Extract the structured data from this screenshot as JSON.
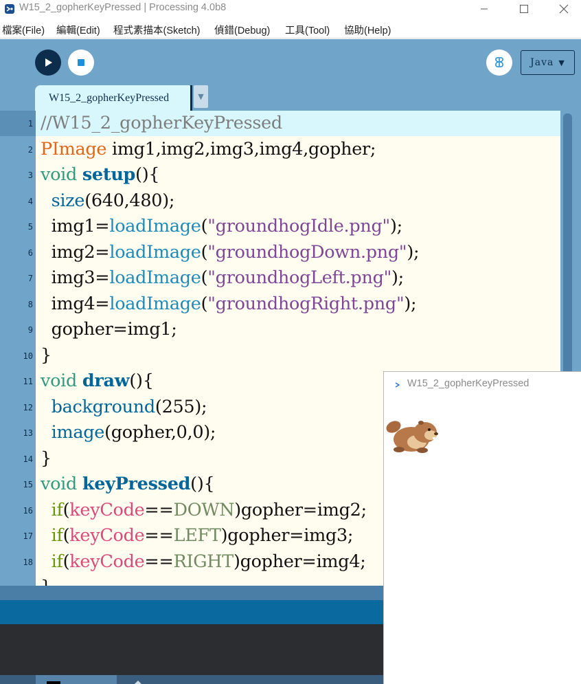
{
  "window": {
    "title": "W15_2_gopherKeyPressed | Processing 4.0b8"
  },
  "menu": [
    {
      "label": "檔案(File)"
    },
    {
      "label": "編輯(Edit)"
    },
    {
      "label": "程式素描本(Sketch)"
    },
    {
      "label": "偵錯(Debug)"
    },
    {
      "label": "工具(Tool)"
    },
    {
      "label": "協助(Help)"
    }
  ],
  "toolbar": {
    "mode_label": "Java",
    "mode_arrow": "▼"
  },
  "editor": {
    "tab_name": "W15_2_gopherKeyPressed",
    "tab_menu_arrow": "▼",
    "line_numbers": [
      "1",
      "2",
      "3",
      "4",
      "5",
      "6",
      "7",
      "8",
      "9",
      "10",
      "11",
      "12",
      "13",
      "14",
      "15",
      "16",
      "17",
      "18"
    ],
    "lines": [
      [
        {
          "t": "//W15_2_gopherKeyPressed",
          "c": "k-comment"
        }
      ],
      [
        {
          "t": "PImage",
          "c": "k-type"
        },
        {
          "t": " img1,img2,img3,img4,gopher;",
          "c": ""
        }
      ],
      [
        {
          "t": "void",
          "c": "k-void"
        },
        {
          "t": " ",
          "c": ""
        },
        {
          "t": "setup",
          "c": "k-fn"
        },
        {
          "t": "(){",
          "c": ""
        }
      ],
      [
        {
          "t": "  ",
          "c": ""
        },
        {
          "t": "size",
          "c": "k-call"
        },
        {
          "t": "(640,480);",
          "c": ""
        }
      ],
      [
        {
          "t": "  img1=",
          "c": ""
        },
        {
          "t": "loadImage",
          "c": "k-load"
        },
        {
          "t": "(",
          "c": ""
        },
        {
          "t": "\"groundhogIdle.png\"",
          "c": "k-str"
        },
        {
          "t": ");",
          "c": ""
        }
      ],
      [
        {
          "t": "  img2=",
          "c": ""
        },
        {
          "t": "loadImage",
          "c": "k-load"
        },
        {
          "t": "(",
          "c": ""
        },
        {
          "t": "\"groundhogDown.png\"",
          "c": "k-str"
        },
        {
          "t": ");",
          "c": ""
        }
      ],
      [
        {
          "t": "  img3=",
          "c": ""
        },
        {
          "t": "loadImage",
          "c": "k-load"
        },
        {
          "t": "(",
          "c": ""
        },
        {
          "t": "\"groundhogLeft.png\"",
          "c": "k-str"
        },
        {
          "t": ");",
          "c": ""
        }
      ],
      [
        {
          "t": "  img4=",
          "c": ""
        },
        {
          "t": "loadImage",
          "c": "k-load"
        },
        {
          "t": "(",
          "c": ""
        },
        {
          "t": "\"groundhogRight.png\"",
          "c": "k-str"
        },
        {
          "t": ");",
          "c": ""
        }
      ],
      [
        {
          "t": "  gopher=img1;",
          "c": ""
        }
      ],
      [
        {
          "t": "}",
          "c": ""
        }
      ],
      [
        {
          "t": "void",
          "c": "k-void"
        },
        {
          "t": " ",
          "c": ""
        },
        {
          "t": "draw",
          "c": "k-fn"
        },
        {
          "t": "(){",
          "c": ""
        }
      ],
      [
        {
          "t": "  ",
          "c": ""
        },
        {
          "t": "background",
          "c": "k-call"
        },
        {
          "t": "(255);",
          "c": ""
        }
      ],
      [
        {
          "t": "  ",
          "c": ""
        },
        {
          "t": "image",
          "c": "k-call"
        },
        {
          "t": "(gopher,0,0);",
          "c": ""
        }
      ],
      [
        {
          "t": "}",
          "c": ""
        }
      ],
      [
        {
          "t": "void",
          "c": "k-void"
        },
        {
          "t": " ",
          "c": ""
        },
        {
          "t": "keyPressed",
          "c": "k-fn"
        },
        {
          "t": "(){",
          "c": ""
        }
      ],
      [
        {
          "t": "  ",
          "c": ""
        },
        {
          "t": "if",
          "c": "k-if"
        },
        {
          "t": "(",
          "c": ""
        },
        {
          "t": "keyCode",
          "c": "k-var"
        },
        {
          "t": "==",
          "c": ""
        },
        {
          "t": "DOWN",
          "c": "k-const"
        },
        {
          "t": ")gopher=img2;",
          "c": ""
        }
      ],
      [
        {
          "t": "  ",
          "c": ""
        },
        {
          "t": "if",
          "c": "k-if"
        },
        {
          "t": "(",
          "c": ""
        },
        {
          "t": "keyCode",
          "c": "k-var"
        },
        {
          "t": "==",
          "c": ""
        },
        {
          "t": "LEFT",
          "c": "k-const"
        },
        {
          "t": ")gopher=img3;",
          "c": ""
        }
      ],
      [
        {
          "t": "  ",
          "c": ""
        },
        {
          "t": "if",
          "c": "k-if"
        },
        {
          "t": "(",
          "c": ""
        },
        {
          "t": "keyCode",
          "c": "k-var"
        },
        {
          "t": "==",
          "c": ""
        },
        {
          "t": "RIGHT",
          "c": "k-const"
        },
        {
          "t": ")gopher=img4;",
          "c": ""
        }
      ],
      [
        {
          "t": "}",
          "c": ""
        }
      ]
    ]
  },
  "sketch_window": {
    "title": "W15_2_gopherKeyPressed"
  },
  "colors": {
    "chrome_blue": "#71a4c9",
    "editor_bg": "#fffdf0",
    "current_line": "#d8f7fd",
    "dark_navy": "#0d2d4c",
    "status_blue": "#0a6aa0",
    "console_bg": "#2b2d30"
  },
  "icons": {
    "run": "play-icon",
    "stop": "stop-icon",
    "debug": "butterfly-icon",
    "app": "processing-logo-icon"
  }
}
